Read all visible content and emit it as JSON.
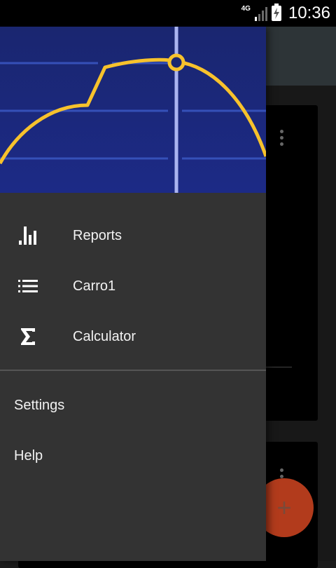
{
  "status_bar": {
    "network": "4G",
    "time": "10:36",
    "icons": [
      "signal-icon",
      "battery-charging-icon"
    ]
  },
  "drawer": {
    "header_graphic": "car-speed-chart-illustration",
    "main_items": [
      {
        "label": "Reports",
        "icon": "bar-chart-icon"
      },
      {
        "label": "Carro1",
        "icon": "list-icon"
      },
      {
        "label": "Calculator",
        "icon": "sigma-icon"
      }
    ],
    "secondary_items": [
      {
        "label": "Settings"
      },
      {
        "label": "Help"
      }
    ]
  },
  "background": {
    "fab_icon": "+",
    "colors": {
      "toolbar": "#2d3437",
      "fab": "#b23b1c"
    }
  },
  "colors": {
    "drawer_bg": "#333333",
    "header_bg": "#1a2a7a",
    "header_accent": "#f7c22c"
  }
}
